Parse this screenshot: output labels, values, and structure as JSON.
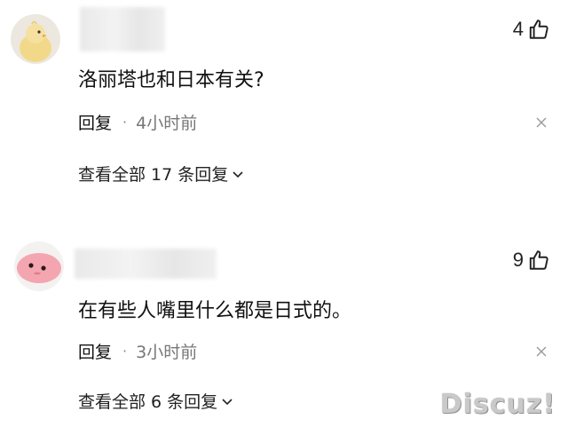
{
  "comments": [
    {
      "avatar_icon": "chick-avatar-icon",
      "likes": "4",
      "text": "洛丽塔也和日本有关?",
      "reply_label": "回复",
      "separator": "·",
      "time": "4小时前",
      "view_replies": "查看全部 17 条回复"
    },
    {
      "avatar_icon": "pink-blob-avatar-icon",
      "likes": "9",
      "text": "在有些人嘴里什么都是日式的。",
      "reply_label": "回复",
      "separator": "·",
      "time": "3小时前",
      "view_replies": "查看全部 6 条回复"
    }
  ],
  "watermark": "Discuz!",
  "colors": {
    "text": "#111111",
    "muted": "#777777",
    "chick_yellow": "#f2d98a",
    "pink": "#f4a6b0"
  }
}
